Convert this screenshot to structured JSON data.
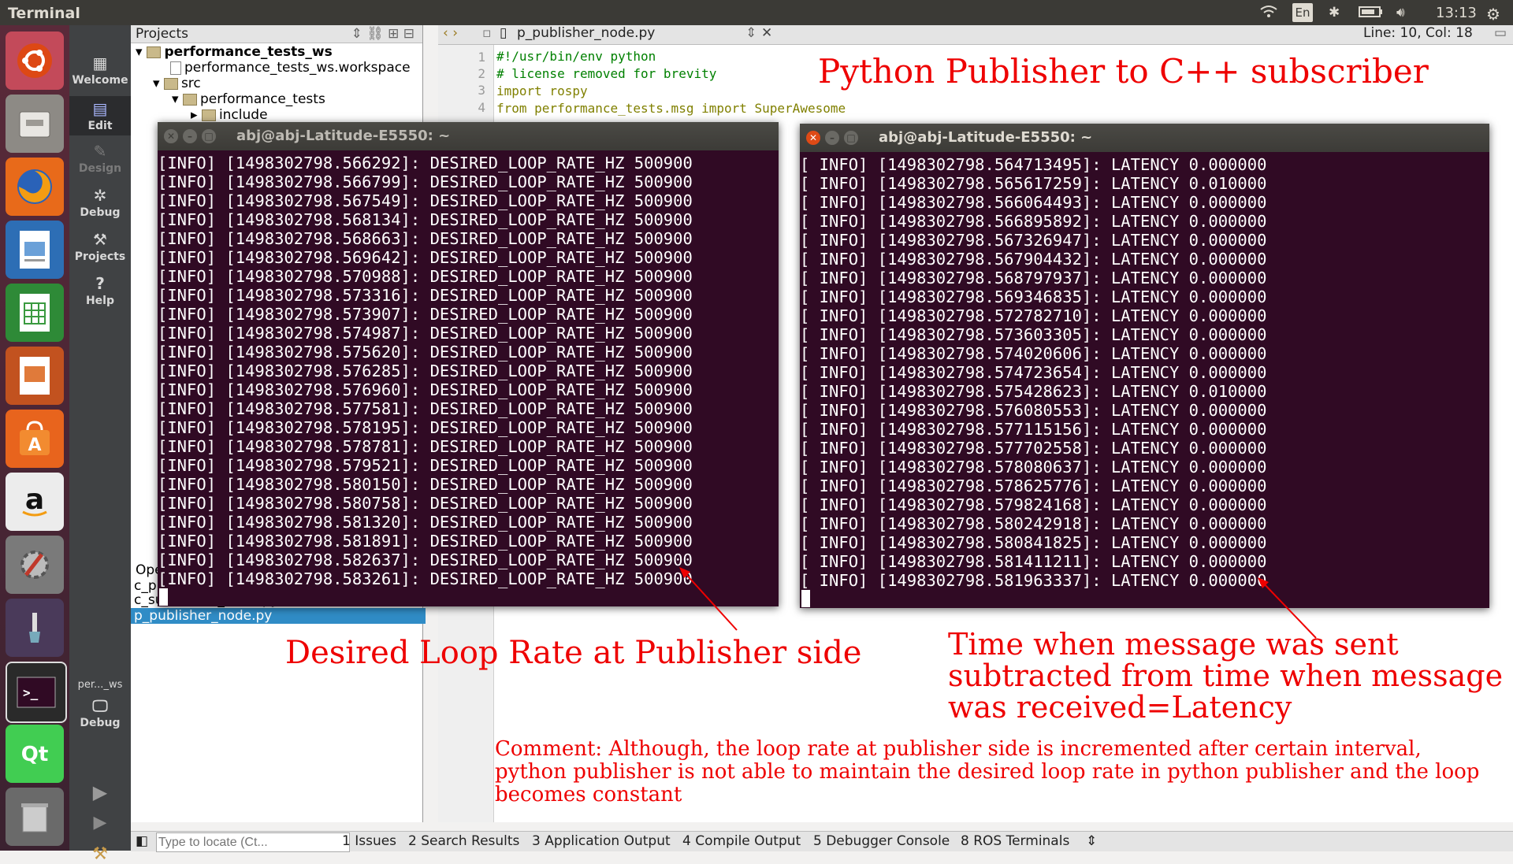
{
  "topbar": {
    "title": "Terminal",
    "lang": "En",
    "time": "13:13"
  },
  "modebar": {
    "welcome": "Welcome",
    "edit": "Edit",
    "design": "Design",
    "debug": "Debug",
    "projects": "Projects",
    "help": "Help",
    "session": "per..._ws",
    "session_mode": "Debug"
  },
  "projects": {
    "header": "Projects",
    "root": "performance_tests_ws",
    "workspace_file": "performance_tests_ws.workspace",
    "src": "src",
    "pkg": "performance_tests",
    "include": "include",
    "open_docs_header": "Ope",
    "open_doc_1": "c_p",
    "open_doc_2": "c_subscriber_node.py",
    "open_doc_3": "p_publisher_node.py"
  },
  "editor": {
    "tab": "p_publisher_node.py",
    "position": "Line: 10, Col: 18",
    "lines": [
      {
        "n": "1",
        "text": "#!/usr/bin/env python"
      },
      {
        "n": "2",
        "text": "# license removed for brevity"
      },
      {
        "n": "3",
        "text": "import rospy"
      },
      {
        "n": "4",
        "text": "from performance_tests.msg import SuperAwesome"
      }
    ]
  },
  "term_left": {
    "title": "abj@abj-Latitude-E5550: ~",
    "lines": [
      "[INFO] [1498302798.566292]: DESIRED_LOOP_RATE_HZ 500900",
      "[INFO] [1498302798.566799]: DESIRED_LOOP_RATE_HZ 500900",
      "[INFO] [1498302798.567549]: DESIRED_LOOP_RATE_HZ 500900",
      "[INFO] [1498302798.568134]: DESIRED_LOOP_RATE_HZ 500900",
      "[INFO] [1498302798.568663]: DESIRED_LOOP_RATE_HZ 500900",
      "[INFO] [1498302798.569642]: DESIRED_LOOP_RATE_HZ 500900",
      "[INFO] [1498302798.570988]: DESIRED_LOOP_RATE_HZ 500900",
      "[INFO] [1498302798.573316]: DESIRED_LOOP_RATE_HZ 500900",
      "[INFO] [1498302798.573907]: DESIRED_LOOP_RATE_HZ 500900",
      "[INFO] [1498302798.574987]: DESIRED_LOOP_RATE_HZ 500900",
      "[INFO] [1498302798.575620]: DESIRED_LOOP_RATE_HZ 500900",
      "[INFO] [1498302798.576285]: DESIRED_LOOP_RATE_HZ 500900",
      "[INFO] [1498302798.576960]: DESIRED_LOOP_RATE_HZ 500900",
      "[INFO] [1498302798.577581]: DESIRED_LOOP_RATE_HZ 500900",
      "[INFO] [1498302798.578195]: DESIRED_LOOP_RATE_HZ 500900",
      "[INFO] [1498302798.578781]: DESIRED_LOOP_RATE_HZ 500900",
      "[INFO] [1498302798.579521]: DESIRED_LOOP_RATE_HZ 500900",
      "[INFO] [1498302798.580150]: DESIRED_LOOP_RATE_HZ 500900",
      "[INFO] [1498302798.580758]: DESIRED_LOOP_RATE_HZ 500900",
      "[INFO] [1498302798.581320]: DESIRED_LOOP_RATE_HZ 500900",
      "[INFO] [1498302798.581891]: DESIRED_LOOP_RATE_HZ 500900",
      "[INFO] [1498302798.582637]: DESIRED_LOOP_RATE_HZ 500900",
      "[INFO] [1498302798.583261]: DESIRED_LOOP_RATE_HZ 500900"
    ]
  },
  "term_right": {
    "title": "abj@abj-Latitude-E5550: ~",
    "lines": [
      "[ INFO] [1498302798.564713495]: LATENCY 0.000000",
      "[ INFO] [1498302798.565617259]: LATENCY 0.010000",
      "[ INFO] [1498302798.566064493]: LATENCY 0.000000",
      "[ INFO] [1498302798.566895892]: LATENCY 0.000000",
      "[ INFO] [1498302798.567326947]: LATENCY 0.000000",
      "[ INFO] [1498302798.567904432]: LATENCY 0.000000",
      "[ INFO] [1498302798.568797937]: LATENCY 0.000000",
      "[ INFO] [1498302798.569346835]: LATENCY 0.000000",
      "[ INFO] [1498302798.572782710]: LATENCY 0.000000",
      "[ INFO] [1498302798.573603305]: LATENCY 0.000000",
      "[ INFO] [1498302798.574020606]: LATENCY 0.000000",
      "[ INFO] [1498302798.574723654]: LATENCY 0.000000",
      "[ INFO] [1498302798.575428623]: LATENCY 0.010000",
      "[ INFO] [1498302798.576080553]: LATENCY 0.000000",
      "[ INFO] [1498302798.577115156]: LATENCY 0.000000",
      "[ INFO] [1498302798.577702558]: LATENCY 0.000000",
      "[ INFO] [1498302798.578080637]: LATENCY 0.000000",
      "[ INFO] [1498302798.578625776]: LATENCY 0.000000",
      "[ INFO] [1498302798.579824168]: LATENCY 0.000000",
      "[ INFO] [1498302798.580242918]: LATENCY 0.000000",
      "[ INFO] [1498302798.580841825]: LATENCY 0.000000",
      "[ INFO] [1498302798.581411211]: LATENCY 0.000000",
      "[ INFO] [1498302798.581963337]: LATENCY 0.000000"
    ]
  },
  "annotations": {
    "title": "Python Publisher to C++ subscriber",
    "loop_rate": "Desired Loop Rate at Publisher side",
    "latency_1": "Time when message was sent",
    "latency_2": "subtracted from time when message",
    "latency_3": "was received=Latency",
    "comment_1": "Comment: Although, the loop rate at publisher side is incremented after certain interval,",
    "comment_2": "python publisher is not able to maintain the desired loop rate in python publisher and the loop",
    "comment_3": "becomes constant"
  },
  "statusbar": {
    "locate_placeholder": "Type to locate (Ct...",
    "issues": "1 Issues",
    "search": "2 Search Results",
    "app_output": "3 Application Output",
    "compile": "4 Compile Output",
    "debugger": "5 Debugger Console",
    "ros": "8 ROS Terminals"
  },
  "colors": {
    "terminal_bg": "#300a24",
    "annotation": "#ee0000",
    "launcher": "#4a2636"
  }
}
